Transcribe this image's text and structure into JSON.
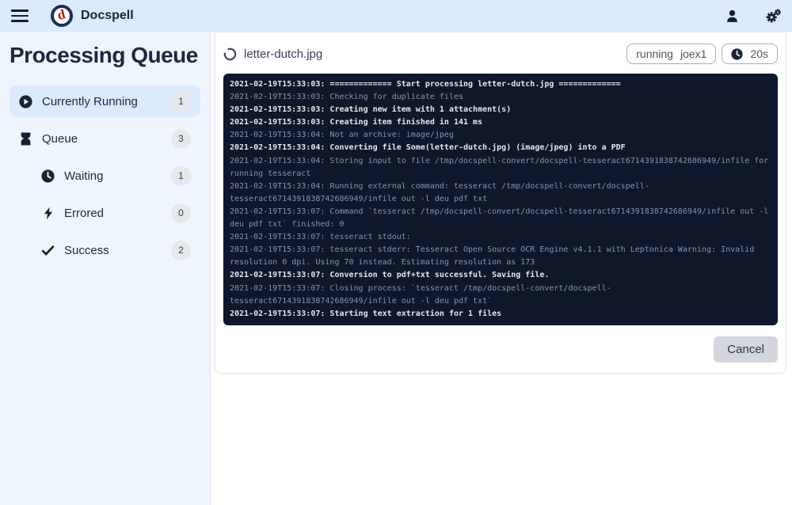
{
  "navbar": {
    "title": "Docspell",
    "icons": [
      "hamburger-menu-icon",
      "app-logo",
      "user-icon",
      "settings-gears-icon"
    ]
  },
  "sidebar": {
    "title": "Processing Queue",
    "items": [
      {
        "label": "Currently Running",
        "count": "1",
        "icon": "play-circle-icon",
        "selected": true,
        "indent": false
      },
      {
        "label": "Queue",
        "count": "3",
        "icon": "hourglass-icon",
        "selected": false,
        "indent": false
      },
      {
        "label": "Waiting",
        "count": "1",
        "icon": "clock-icon",
        "selected": false,
        "indent": true
      },
      {
        "label": "Errored",
        "count": "0",
        "icon": "bolt-icon",
        "selected": false,
        "indent": true
      },
      {
        "label": "Success",
        "count": "2",
        "icon": "check-icon",
        "selected": false,
        "indent": true
      }
    ]
  },
  "job": {
    "filename": "letter-dutch.jpg",
    "state": "running",
    "worker": "joex1",
    "duration": "20s",
    "cancel_label": "Cancel",
    "header_icon": "circle-notch-icon",
    "duration_icon": "clock-icon"
  },
  "log": {
    "lines": [
      {
        "level": "info",
        "text": "2021-02-19T15:33:03: ============= Start processing letter-dutch.jpg ============="
      },
      {
        "level": "debug",
        "text": "2021-02-19T15:33:03: Checking for duplicate files"
      },
      {
        "level": "info",
        "text": "2021-02-19T15:33:03: Creating new item with 1 attachment(s)"
      },
      {
        "level": "info",
        "text": "2021-02-19T15:33:03: Creating item finished in 141 ms"
      },
      {
        "level": "debug",
        "text": "2021-02-19T15:33:04: Not an archive: image/jpeg"
      },
      {
        "level": "info",
        "text": "2021-02-19T15:33:04: Converting file Some(letter-dutch.jpg) (image/jpeg) into a PDF"
      },
      {
        "level": "debug",
        "text": "2021-02-19T15:33:04: Storing input to file /tmp/docspell-convert/docspell-tesseract6714391838742686949/infile for running tesseract"
      },
      {
        "level": "debug",
        "text": "2021-02-19T15:33:04: Running external command: tesseract /tmp/docspell-convert/docspell-tesseract6714391838742686949/infile out -l deu pdf txt"
      },
      {
        "level": "debug",
        "text": "2021-02-19T15:33:07: Command `tesseract /tmp/docspell-convert/docspell-tesseract6714391838742686949/infile out -l deu pdf txt` finished: 0"
      },
      {
        "level": "debug",
        "text": "2021-02-19T15:33:07: tesseract stdout:"
      },
      {
        "level": "debug",
        "text": "2021-02-19T15:33:07: tesseract stderr: Tesseract Open Source OCR Engine v4.1.1 with Leptonica Warning: Invalid resolution 0 dpi. Using 70 instead. Estimating resolution as 173"
      },
      {
        "level": "info",
        "text": "2021-02-19T15:33:07: Conversion to pdf+txt successful. Saving file."
      },
      {
        "level": "debug",
        "text": "2021-02-19T15:33:07: Closing process: `tesseract /tmp/docspell-convert/docspell-tesseract6714391838742686949/infile out -l deu pdf txt`"
      },
      {
        "level": "info",
        "text": "2021-02-19T15:33:07: Starting text extraction for 1 files"
      }
    ]
  },
  "colors": {
    "navbar_bg": "#dbeafe",
    "sidebar_bg": "#eef5fe",
    "selected_item_bg": "#dbeafe",
    "badge_bg": "#e5e7eb",
    "log_bg": "#0f172a",
    "log_info": "#e2e8f0",
    "log_debug": "#8296ac",
    "logo_ring": "#1d3054",
    "logo_letter": "#b5121b",
    "cancel_bg": "#d2d6dd"
  }
}
